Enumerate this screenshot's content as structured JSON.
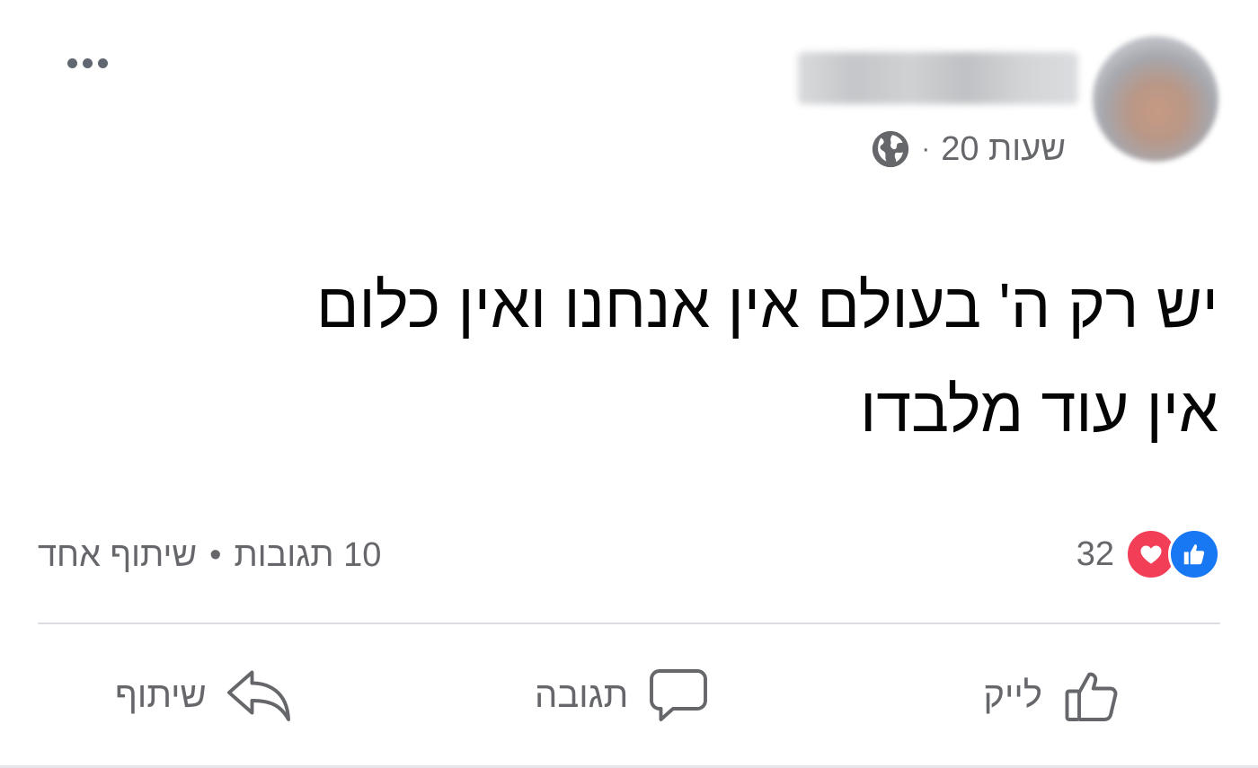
{
  "post": {
    "timestamp": "20 שעות",
    "separator": "·",
    "audience_icon": "globe-icon",
    "text": "יש רק ה' בעולם אין אנחנו ואין כלום\nאין עוד מלבדו"
  },
  "reactions": {
    "types": [
      "like",
      "love"
    ],
    "count": "32"
  },
  "stats": {
    "comments": "10 תגובות",
    "bullet": "•",
    "shares": "שיתוף אחד"
  },
  "actions": {
    "like_label": "לייק",
    "comment_label": "תגובה",
    "share_label": "שיתוף"
  },
  "colors": {
    "like_blue": "#1877f2",
    "love_red": "#f33e58",
    "secondary_text": "#65676b",
    "primary_text": "#050505"
  }
}
